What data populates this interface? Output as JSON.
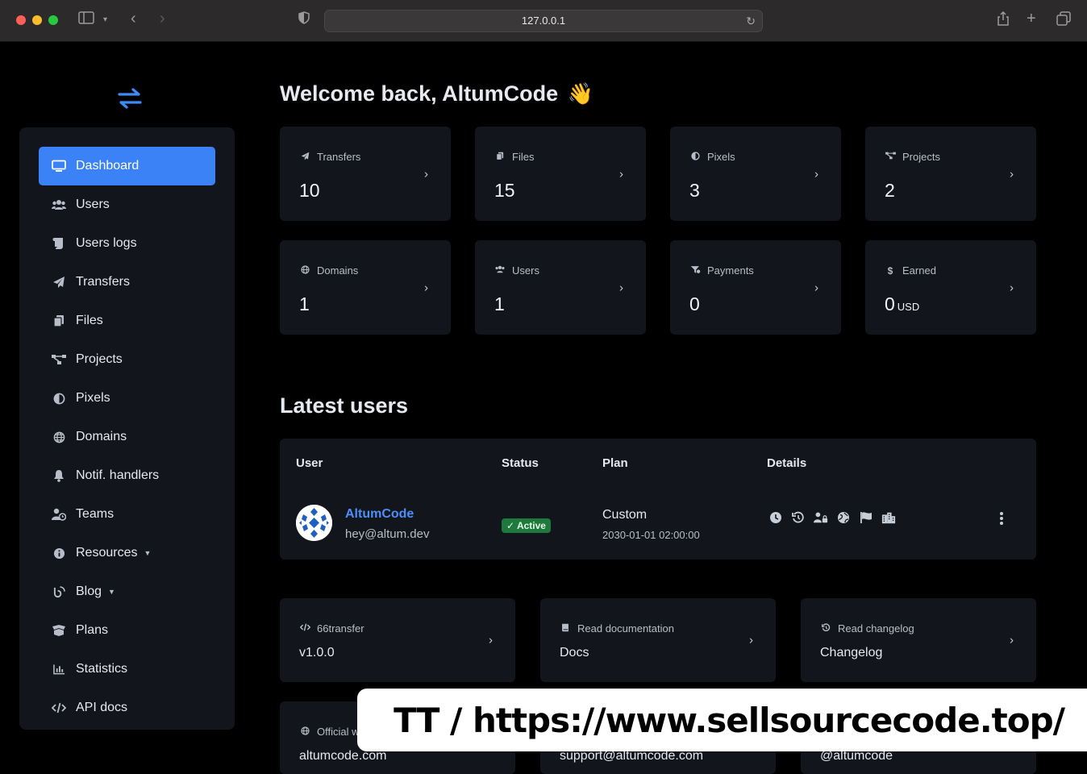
{
  "browser": {
    "url": "127.0.0.1"
  },
  "sidebar": {
    "items": [
      {
        "label": "Dashboard",
        "icon": "monitor-icon"
      },
      {
        "label": "Users",
        "icon": "users-icon"
      },
      {
        "label": "Users logs",
        "icon": "scroll-icon"
      },
      {
        "label": "Transfers",
        "icon": "paper-plane-icon"
      },
      {
        "label": "Files",
        "icon": "copy-icon"
      },
      {
        "label": "Projects",
        "icon": "project-diagram-icon"
      },
      {
        "label": "Pixels",
        "icon": "adjust-icon"
      },
      {
        "label": "Domains",
        "icon": "globe-icon"
      },
      {
        "label": "Notif. handlers",
        "icon": "bell-icon"
      },
      {
        "label": "Teams",
        "icon": "user-clock-icon"
      },
      {
        "label": "Resources",
        "icon": "info-circle-icon"
      },
      {
        "label": "Blog",
        "icon": "blog-icon"
      },
      {
        "label": "Plans",
        "icon": "box-open-icon"
      },
      {
        "label": "Statistics",
        "icon": "chart-bar-icon"
      },
      {
        "label": "API docs",
        "icon": "code-icon"
      }
    ]
  },
  "main": {
    "welcome": "Welcome back, AltumCode",
    "welcome_emoji": "👋",
    "stats": [
      {
        "label": "Transfers",
        "value": "10",
        "icon": "paper-plane-icon"
      },
      {
        "label": "Files",
        "value": "15",
        "icon": "copy-icon"
      },
      {
        "label": "Pixels",
        "value": "3",
        "icon": "adjust-icon"
      },
      {
        "label": "Projects",
        "value": "2",
        "icon": "project-diagram-icon"
      },
      {
        "label": "Domains",
        "value": "1",
        "icon": "globe-icon"
      },
      {
        "label": "Users",
        "value": "1",
        "icon": "users-icon"
      },
      {
        "label": "Payments",
        "value": "0",
        "icon": "funnel-dollar-icon"
      },
      {
        "label": "Earned",
        "value": "0",
        "unit": "USD",
        "icon": "dollar-icon"
      }
    ],
    "latest_users": {
      "title": "Latest users",
      "columns": [
        "User",
        "Status",
        "Plan",
        "Details"
      ],
      "rows": [
        {
          "name": "AltumCode",
          "email": "hey@altum.dev",
          "status": "Active",
          "plan": "Custom",
          "plan_expiry": "2030-01-01 02:00:00"
        }
      ]
    },
    "info_cards": [
      {
        "label": "66transfer",
        "value": "v1.0.0",
        "icon": "code-icon"
      },
      {
        "label": "Read documentation",
        "value": "Docs",
        "icon": "book-icon"
      },
      {
        "label": "Read changelog",
        "value": "Changelog",
        "icon": "history-icon"
      }
    ],
    "bottom_cards": [
      {
        "label": "Official w",
        "value": "altumcode.com",
        "icon": "globe-icon"
      },
      {
        "value": "support@altumcode.com"
      },
      {
        "value": "@altumcode"
      }
    ]
  },
  "watermark": "TT / https://www.sellsourcecode.top/",
  "colors": {
    "accent": "#3b82f6",
    "card": "#12151b",
    "active_badge": "#1d7a3c"
  }
}
